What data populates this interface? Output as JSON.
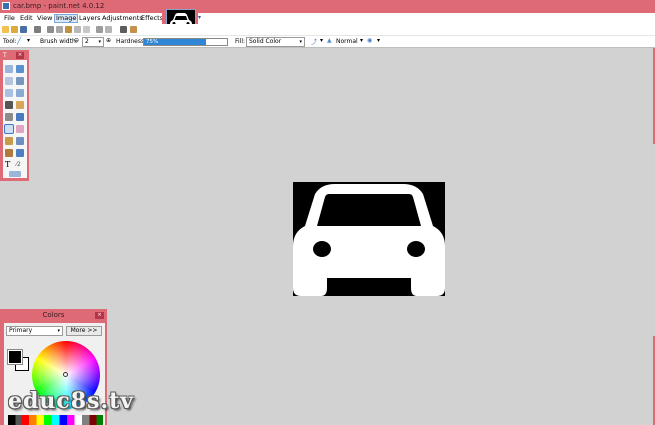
{
  "window": {
    "title": "car.bmp - paint.net 4.0.12"
  },
  "menu": {
    "items": [
      {
        "label": "File"
      },
      {
        "label": "Edit"
      },
      {
        "label": "View"
      },
      {
        "label": "Image"
      },
      {
        "label": "Layers"
      },
      {
        "label": "Adjustments"
      },
      {
        "label": "Effects"
      }
    ]
  },
  "toolbar": {
    "tool_label": "Tool:",
    "brush_width_label": "Brush width:",
    "brush_width_value": "2",
    "hardness_label": "Hardness:",
    "hardness_value": "75%",
    "hardness_fraction": 0.75,
    "fill_label": "Fill:",
    "fill_value": "Solid Color",
    "blend_mode": "Normal"
  },
  "tools_panel": {
    "title": "T",
    "close": "×"
  },
  "colors_panel": {
    "title": "Colors",
    "close": "×",
    "selector": "Primary",
    "more_button": "More >>"
  },
  "watermark": "educ8s.tv",
  "colors": {
    "title_bar": "#de6a76",
    "canvas_bg": "#d2d2d2",
    "image_bg": "#000000",
    "car": "#ffffff",
    "accent": "#2f86d6"
  }
}
